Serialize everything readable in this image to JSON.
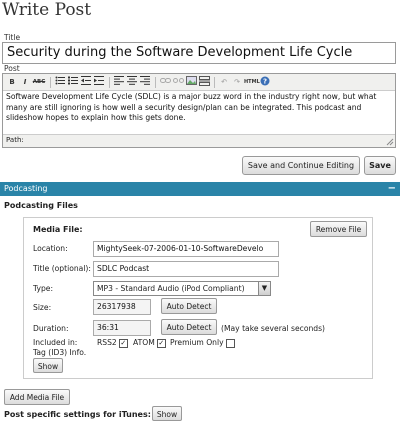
{
  "page_title": "Write Post",
  "title_label": "Title",
  "title_value": "Security during the Software Development Life Cycle",
  "post_label": "Post",
  "toolbar": {
    "bold": "B",
    "italic": "I",
    "strike": "ABC",
    "icons": [
      "bold-icon",
      "italic-icon",
      "strikethrough-icon",
      "bullet-list-icon",
      "numbered-list-icon",
      "outdent-icon",
      "indent-icon",
      "align-left-icon",
      "align-center-icon",
      "align-right-icon",
      "link-icon",
      "unlink-icon",
      "image-icon",
      "more-icon",
      "undo-icon",
      "redo-icon",
      "html-icon",
      "help-icon"
    ]
  },
  "post_content": "Software Development Life Cycle (SDLC) is a major buzz word in the industry right now, but what many are still ignoring is how well a security design/plan can be integrated. This podcast and slideshow hopes to explain how this gets done.",
  "path_label": "Path:",
  "save_continue_label": "Save and Continue Editing",
  "save_label": "Save",
  "podcasting": {
    "bar_title": "Podcasting",
    "collapse_symbol": "−",
    "section_title": "Podcasting Files",
    "media_title": "Media File:",
    "remove_label": "Remove File",
    "location_label": "Location:",
    "location_value": "MightySeek-07-2006-01-10-SoftwareDevelo",
    "title_opt_label": "Title (optional):",
    "title_opt_value": "SDLC Podcast",
    "type_label": "Type:",
    "type_value": "MP3 - Standard Audio (iPod Compliant)",
    "size_label": "Size:",
    "size_value": "26317938",
    "duration_label": "Duration:",
    "duration_value": "36:31",
    "auto_detect_label": "Auto Detect",
    "duration_note": "(May take several seconds)",
    "included_label": "Included in:",
    "rss2_label": "RSS2",
    "atom_label": "ATOM",
    "premium_label": "Premium Only",
    "tag_label": "Tag (ID3) Info.",
    "show_label": "Show",
    "add_media_label": "Add Media File",
    "itunes_label": "Post specific settings for iTunes:"
  }
}
